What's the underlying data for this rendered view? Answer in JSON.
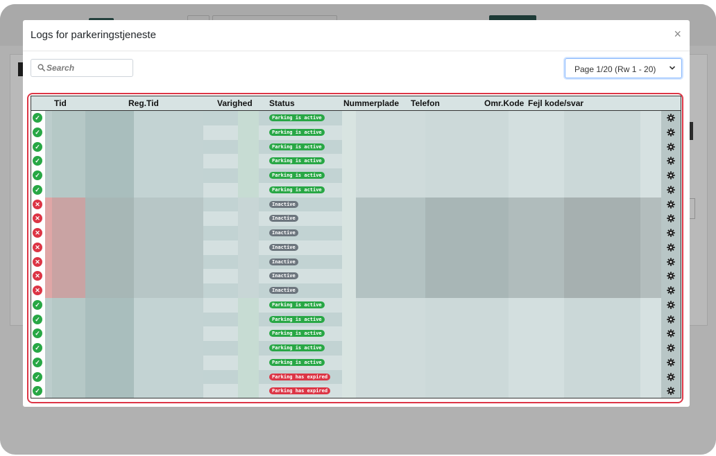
{
  "modal": {
    "title": "Logs for parkeringstjeneste",
    "close_label": "×"
  },
  "search": {
    "placeholder": "Search"
  },
  "pagination": {
    "selected": "Page 1/20 (Rw 1 - 20)"
  },
  "columns": [
    "Tid",
    "Reg.Tid",
    "Varighed",
    "Status",
    "Nummerplade",
    "Telefon",
    "Omr.Kode",
    "Fejl kode/svar"
  ],
  "colors": {
    "success": "#28a745",
    "danger": "#dc3545",
    "secondary": "#6c757d",
    "header_bg": "#d7e3e3"
  },
  "rows": [
    {
      "state": "ok",
      "status": "Parking is active"
    },
    {
      "state": "ok",
      "status": "Parking is active"
    },
    {
      "state": "ok",
      "status": "Parking is active"
    },
    {
      "state": "ok",
      "status": "Parking is active"
    },
    {
      "state": "ok",
      "status": "Parking is active"
    },
    {
      "state": "ok",
      "status": "Parking is active"
    },
    {
      "state": "err",
      "status": "Inactive"
    },
    {
      "state": "err",
      "status": "Inactive"
    },
    {
      "state": "err",
      "status": "Inactive"
    },
    {
      "state": "err",
      "status": "Inactive"
    },
    {
      "state": "err",
      "status": "Inactive"
    },
    {
      "state": "err",
      "status": "Inactive"
    },
    {
      "state": "err",
      "status": "Inactive"
    },
    {
      "state": "ok",
      "status": "Parking is active"
    },
    {
      "state": "ok",
      "status": "Parking is active"
    },
    {
      "state": "ok",
      "status": "Parking is active"
    },
    {
      "state": "ok",
      "status": "Parking is active"
    },
    {
      "state": "ok",
      "status": "Parking is active"
    },
    {
      "state": "ok",
      "status": "Parking has expired"
    },
    {
      "state": "ok",
      "status": "Parking has expired"
    }
  ]
}
